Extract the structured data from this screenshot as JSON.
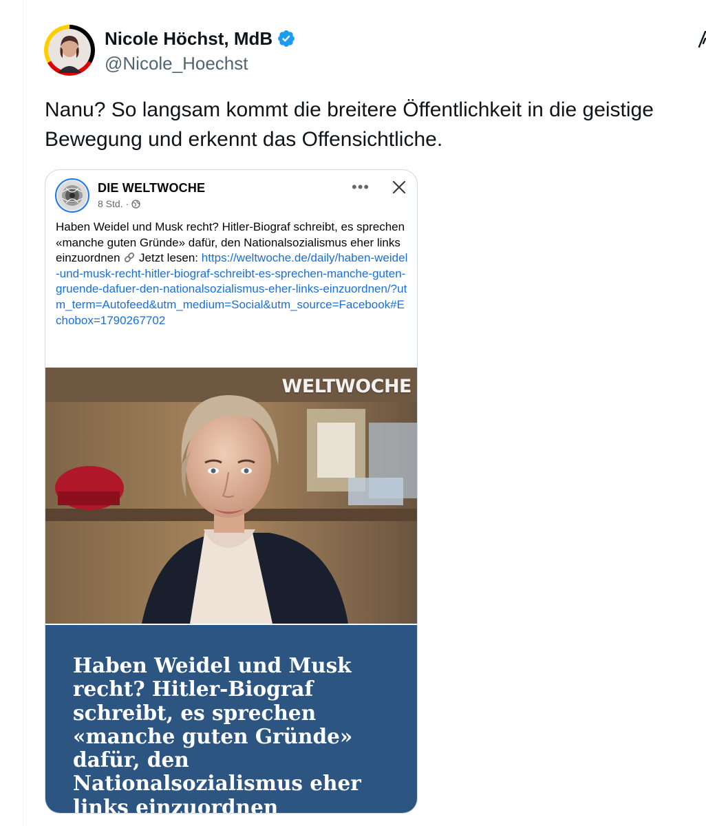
{
  "tweet": {
    "author": {
      "name": "Nicole Höchst, MdB",
      "handle": "@Nicole_Hoechst",
      "verified": true
    },
    "text": "Nanu? So langsam kommt die breitere Öffentlichkeit in die geistige Bewegung und erkennt das Offensichtliche."
  },
  "embed": {
    "page_name": "DIE WELTWOCHE",
    "time": "8 Std.",
    "separator": "·",
    "more_label": "•••",
    "caption": "Haben Weidel und Musk recht? Hitler-Biograf schreibt, es sprechen «manche guten Gründe» dafür, den Nationalsozialismus eher links einzuordnen",
    "read_label": "Jetzt lesen:",
    "url": "https://weltwoche.de/daily/haben-weidel-und-musk-recht-hitler-biograf-schreibt-es-sprechen-manche-guten-gruende-dafuer-den-nationalsozialismus-eher-links-einzuordnen/?utm_term=Autofeed&utm_medium=Social&utm_source=Facebook#Echobox=1790267702",
    "image_brand": "WELTWOCHE",
    "headline": "Haben Weidel und Musk recht? Hitler-Biograf schreibt, es sprechen «manche guten Gründe» dafür, den Nationalsozialismus eher links einzuordnen"
  },
  "colors": {
    "verified": "#1d9bf0",
    "link": "#1a6fd6",
    "headline_panel": "#2c5582",
    "handle_gray": "#536471"
  },
  "icons": {
    "verified": "verified-badge-icon",
    "globe": "globe-icon",
    "close": "close-icon",
    "more": "more-options-icon",
    "link": "link-emoji-icon",
    "grok": "grok-icon"
  }
}
